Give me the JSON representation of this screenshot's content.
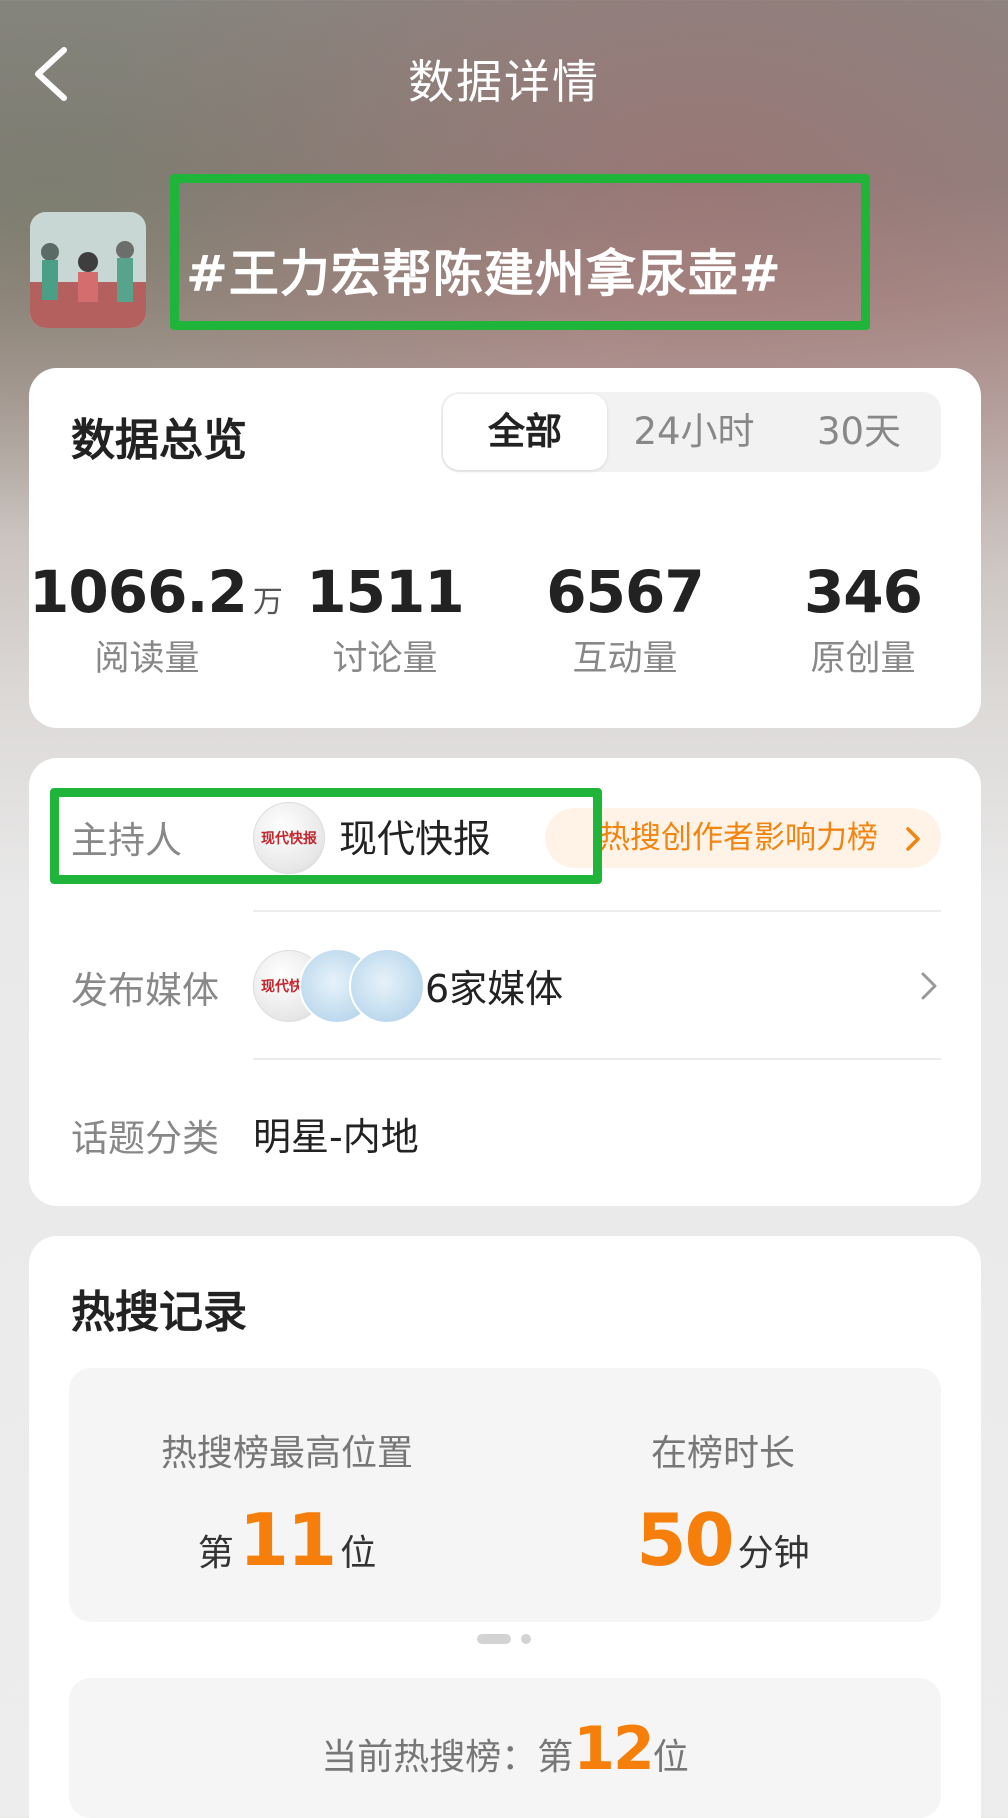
{
  "nav": {
    "title": "数据详情",
    "back_icon": "chevron-left-icon"
  },
  "topic": {
    "title": "#王力宏帮陈建州拿尿壶#"
  },
  "overview": {
    "title": "数据总览",
    "tabs": [
      {
        "label": "全部",
        "active": true
      },
      {
        "label": "24小时",
        "active": false
      },
      {
        "label": "30天",
        "active": false
      }
    ],
    "stats": [
      {
        "value": "1066.2",
        "unit": "万",
        "label": "阅读量"
      },
      {
        "value": "1511",
        "unit": "",
        "label": "讨论量"
      },
      {
        "value": "6567",
        "unit": "",
        "label": "互动量"
      },
      {
        "value": "346",
        "unit": "",
        "label": "原创量"
      }
    ]
  },
  "info": {
    "host_label": "主持人",
    "host_name": "现代快报",
    "host_logo_text": "现代快报",
    "rank_link": "热搜创作者影响力榜",
    "media_label": "发布媒体",
    "media_count": "6家媒体",
    "category_label": "话题分类",
    "category_value": "明星-内地"
  },
  "hot": {
    "title": "热搜记录",
    "peak_label": "热搜榜最高位置",
    "peak_prefix": "第",
    "peak_value": "11",
    "peak_suffix": "位",
    "duration_label": "在榜时长",
    "duration_value": "50",
    "duration_unit": "分钟",
    "current_label": "当前热搜榜：第",
    "current_value": "12",
    "current_suffix": "位"
  },
  "colors": {
    "accent_orange": "#f57f0a",
    "highlight_green": "#1fb53a"
  }
}
